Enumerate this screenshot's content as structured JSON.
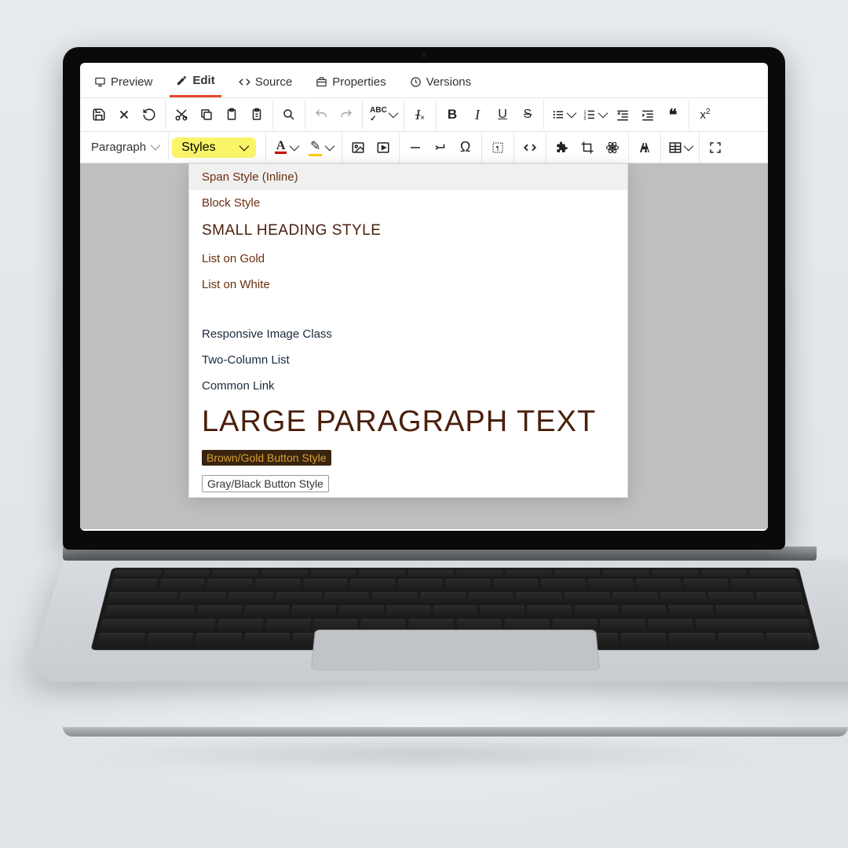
{
  "tabs": {
    "preview": "Preview",
    "edit": "Edit",
    "source": "Source",
    "properties": "Properties",
    "versions": "Versions"
  },
  "format_dropdown": "Paragraph",
  "styles_dropdown": "Styles",
  "styles_menu": {
    "span_inline": "Span Style (Inline)",
    "block": "Block Style",
    "small_heading": "SMALL HEADING STYLE",
    "list_gold": "List on Gold",
    "list_white": "List on White",
    "responsive_img": "Responsive Image Class",
    "two_col": "Two-Column List",
    "common_link": "Common Link",
    "large_para": "LARGE PARAGRAPH TEXT",
    "brown_gold_btn": "Brown/Gold Button Style",
    "gray_black_btn": "Gray/Black Button Style"
  }
}
